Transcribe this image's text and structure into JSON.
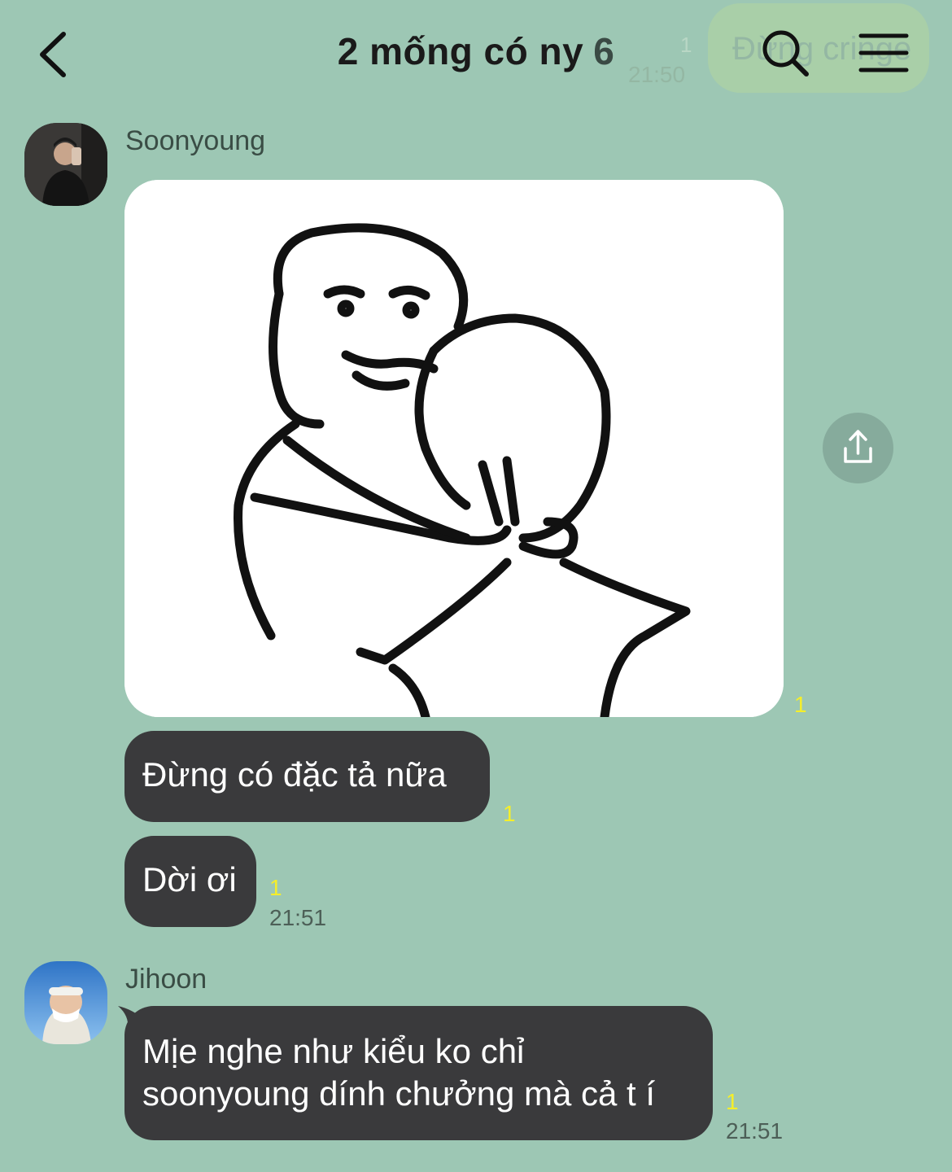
{
  "header": {
    "title": "2 mống có ny",
    "member_count": "6",
    "back_icon": "chevron-left-icon",
    "search_icon": "search-icon",
    "menu_icon": "hamburger-menu-icon"
  },
  "ghost_message": {
    "text": "Đừng cringe",
    "unread": "1",
    "time": "21:50"
  },
  "messages": [
    {
      "sender": "Soonyoung",
      "image": {
        "description_icon": "meme-hug-image",
        "unread": "1",
        "share_icon": "share-icon"
      },
      "texts": [
        {
          "text": "Đừng có đặc tả nữa",
          "unread": "1"
        },
        {
          "text": "Dời ơi",
          "unread": "1",
          "time": "21:51"
        }
      ]
    },
    {
      "sender": "Jihoon",
      "texts": [
        {
          "text_line1": "Mịe nghe như kiểu ko chỉ",
          "text_line2": "soonyoung dính chưởng mà cả t í",
          "unread": "1",
          "time": "21:51"
        }
      ]
    }
  ],
  "colors": {
    "background": "#9dc7b4",
    "bubble": "#3a3a3c",
    "unread": "#f5ee2a"
  }
}
